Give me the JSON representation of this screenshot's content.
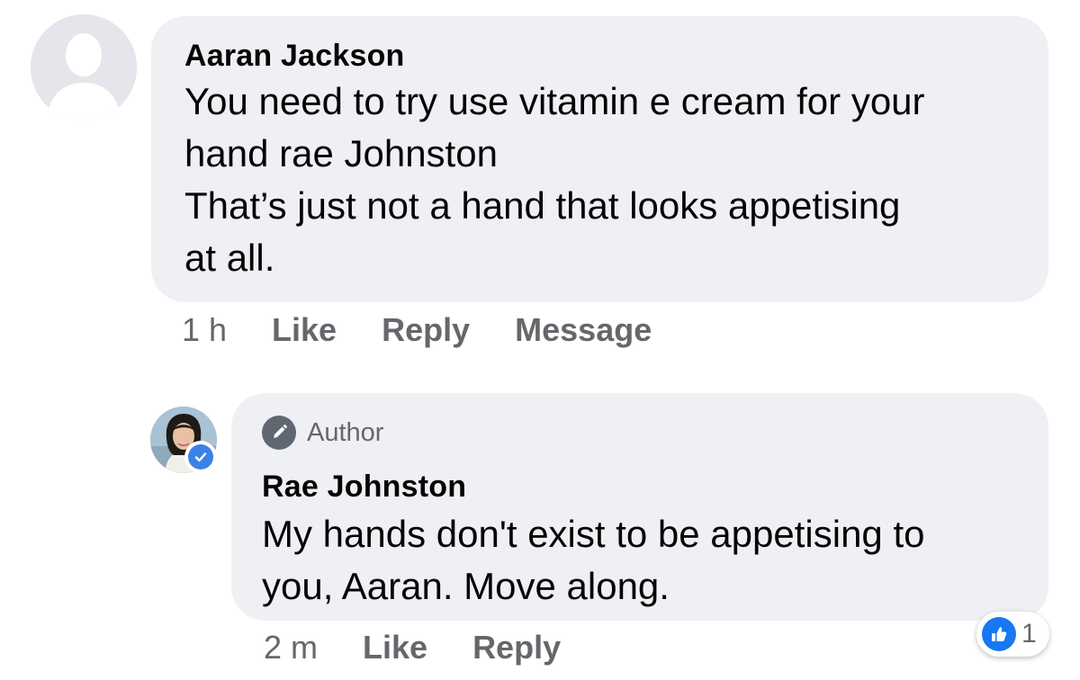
{
  "comments": [
    {
      "author": "Aaran Jackson",
      "text": "You need to try use vitamin e cream for your\nhand rae Johnston\nThat’s just not a hand that looks appetising\nat all.",
      "time": "1 h",
      "actions": {
        "like": "Like",
        "reply": "Reply",
        "message": "Message"
      }
    },
    {
      "badge": "Author",
      "author": "Rae Johnston",
      "text": "My hands don't exist to be appetising to\nyou, Aaran. Move along.",
      "time": "2 m",
      "actions": {
        "like": "Like",
        "reply": "Reply"
      },
      "reactions": {
        "count": "1",
        "icon": "thumbs-up-icon"
      },
      "verified": true
    }
  ],
  "colors": {
    "bubble": "#eff0f4",
    "meta_text": "#65676b",
    "like_blue": "#1877f2",
    "verified_blue": "#3b82e6"
  }
}
